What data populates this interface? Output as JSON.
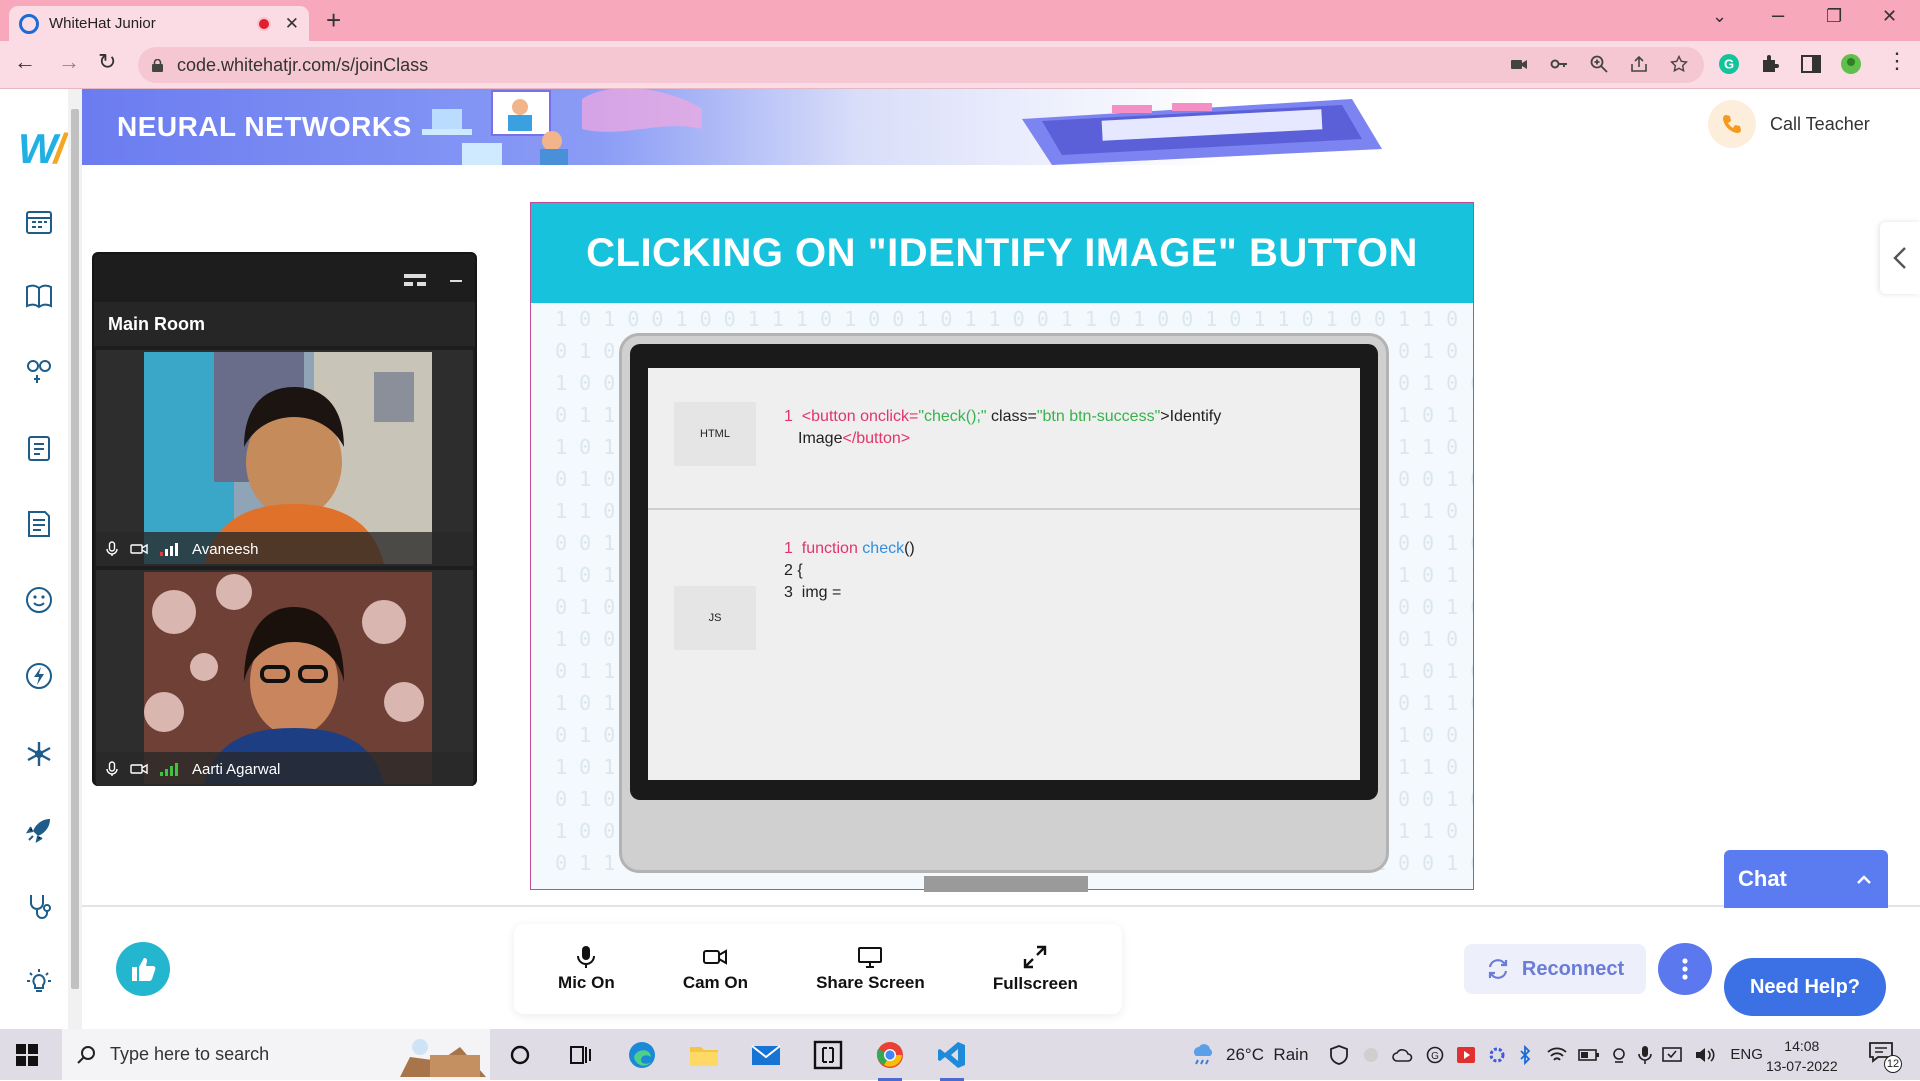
{
  "browser": {
    "tab_title": "WhiteHat Junior",
    "url": "code.whitehatjr.com/s/joinClass"
  },
  "banner": {
    "course_title": "NEURAL NETWORKS",
    "call_teacher": "Call Teacher"
  },
  "sidebar": {
    "icons": [
      "calendar-icon",
      "book-icon",
      "gamepad-icon",
      "notes-icon",
      "document-icon",
      "smiley-icon",
      "lightning-icon",
      "snowflake-icon",
      "rocket-icon",
      "stethoscope-icon",
      "bulb-icon"
    ]
  },
  "video_panel": {
    "room": "Main Room",
    "participants": [
      {
        "name": "Avaneesh"
      },
      {
        "name": "Aarti Agarwal"
      }
    ]
  },
  "slide": {
    "heading": "CLICKING ON \"IDENTIFY IMAGE\" BUTTON",
    "html_label": "HTML",
    "js_label": "JS",
    "html_code": {
      "ln1": "1",
      "p1": "<button onclick=",
      "p2": "\"check();\"",
      "p3": " class=",
      "p4": "\"btn btn-success\"",
      "p5": ">Identify",
      "p6": "Image",
      "p7": "</button>"
    },
    "js_code": {
      "ln1": "1",
      "kw": "function",
      "fn": "check",
      "paren": "()",
      "line2": "2 {",
      "line3": "3  img ="
    }
  },
  "controls": {
    "mic": "Mic On",
    "cam": "Cam On",
    "share": "Share Screen",
    "fullscreen": "Fullscreen"
  },
  "chat": {
    "label": "Chat"
  },
  "reconnect": {
    "label": "Reconnect"
  },
  "help": {
    "label": "Need Help?"
  },
  "taskbar": {
    "search_placeholder": "Type here to search",
    "weather": "26°C  Rain",
    "lang": "ENG",
    "time": "14:08",
    "date": "13-07-2022",
    "notif_count": "12"
  },
  "colors": {
    "tab_strip": "#f7a8ba",
    "slide_header": "#17c3dc",
    "chat_blue": "#5b7cf0",
    "help_blue": "#3c71e6",
    "like_teal": "#25b6cf"
  }
}
